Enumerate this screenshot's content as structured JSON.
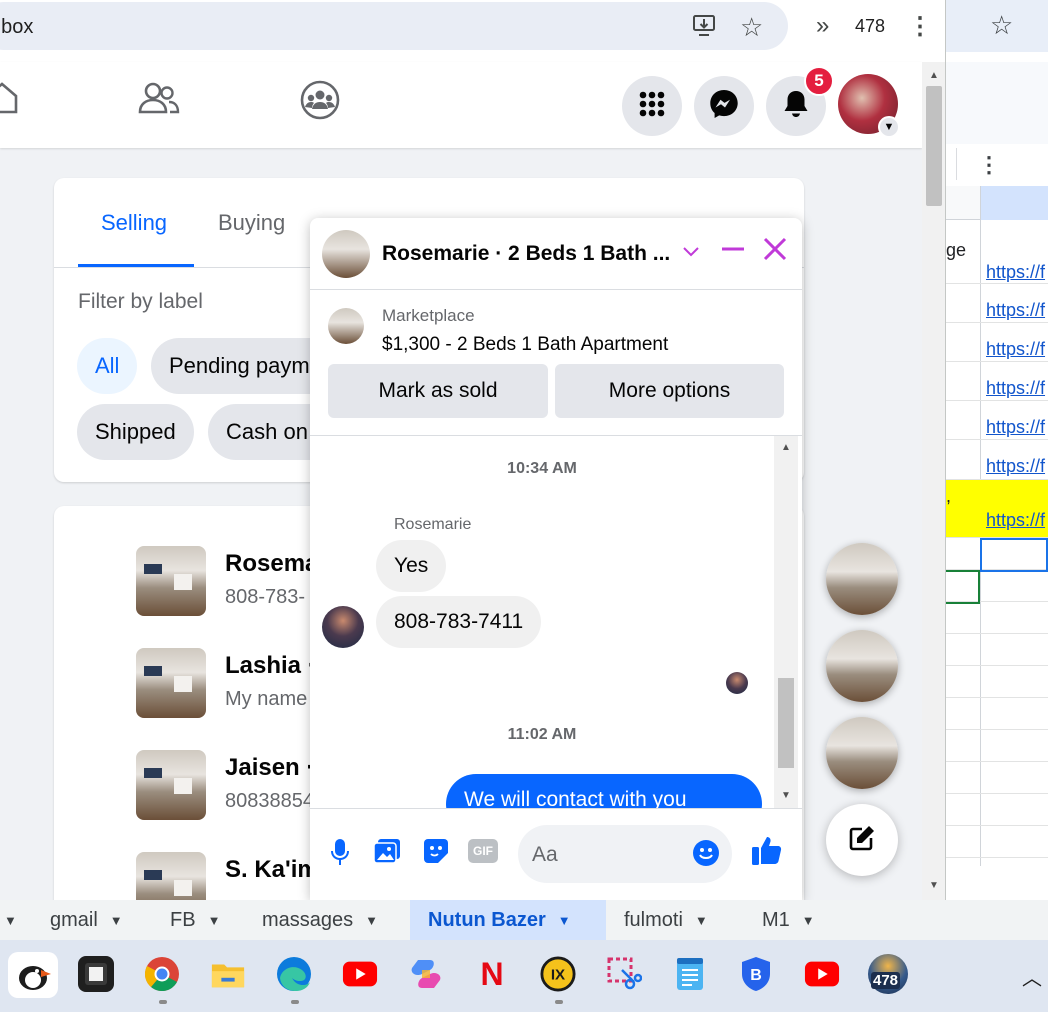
{
  "browser": {
    "url": "/inbox",
    "extension_count": "478",
    "icons": [
      "install-app-icon",
      "bookmark-star-icon",
      "extensions-overflow-icon",
      "menu-kebab-icon"
    ]
  },
  "fb_nav": {
    "icons": [
      "home-icon",
      "friends-icon",
      "groups-icon",
      "apps-grid-icon",
      "messenger-icon",
      "notifications-bell-icon"
    ],
    "notification_count": "5"
  },
  "marketplace_panel": {
    "tabs": [
      {
        "label": "Selling",
        "active": true
      },
      {
        "label": "Buying",
        "active": false
      }
    ],
    "filter_label": "Filter by label",
    "chips": [
      "All",
      "Pending paym",
      "Shipped",
      "Cash on"
    ],
    "active_chip": "All"
  },
  "conversations": [
    {
      "name": "Rosema",
      "preview": "808-783-"
    },
    {
      "name": "Lashia ·",
      "preview": "My name"
    },
    {
      "name": "Jaisen ·",
      "preview": "80838854"
    },
    {
      "name": "S. Ka'im",
      "preview": ""
    }
  ],
  "chat": {
    "title": "Rosemarie · 2 Beds 1 Bath ...",
    "marketplace_label": "Marketplace",
    "listing_title": "$1,300 - 2 Beds 1 Bath Apartment",
    "buttons": {
      "mark_sold": "Mark as sold",
      "more_options": "More options"
    },
    "messages": {
      "time_1": "10:34 AM",
      "sender": "Rosemarie",
      "in_1": "Yes",
      "in_2": "808-783-7411",
      "time_2": "11:02 AM",
      "out_1": "We will contact with you"
    },
    "composer_placeholder": "Aa",
    "composer_icons": [
      "microphone-icon",
      "photo-icon",
      "sticker-icon",
      "gif-icon",
      "emoji-icon",
      "like-thumb-icon"
    ]
  },
  "spreadsheet": {
    "row_text_1": "ge",
    "row_text_2": ",",
    "link_text": "https://f"
  },
  "sheet_tabs": [
    {
      "label": "gmail",
      "active": false
    },
    {
      "label": "FB",
      "active": false
    },
    {
      "label": "massages",
      "active": false
    },
    {
      "label": "Nutun Bazer",
      "active": true
    },
    {
      "label": "fulmoti",
      "active": false
    },
    {
      "label": "M1",
      "active": false
    }
  ],
  "taskbar": {
    "apps": [
      "puffin-app",
      "terminal-app",
      "chrome-app",
      "file-explorer-app",
      "edge-app",
      "youtube-app",
      "copilot-app",
      "netflix-app",
      "ix-app",
      "snipping-tool-app",
      "notepad-app",
      "bitwarden-app",
      "youtube-app-2",
      "news-badge-app"
    ],
    "news_badge": "478"
  },
  "colors": {
    "fb_blue": "#0866ff",
    "chat_accent": "#c03ad8",
    "notif_red": "#e41e3f"
  }
}
